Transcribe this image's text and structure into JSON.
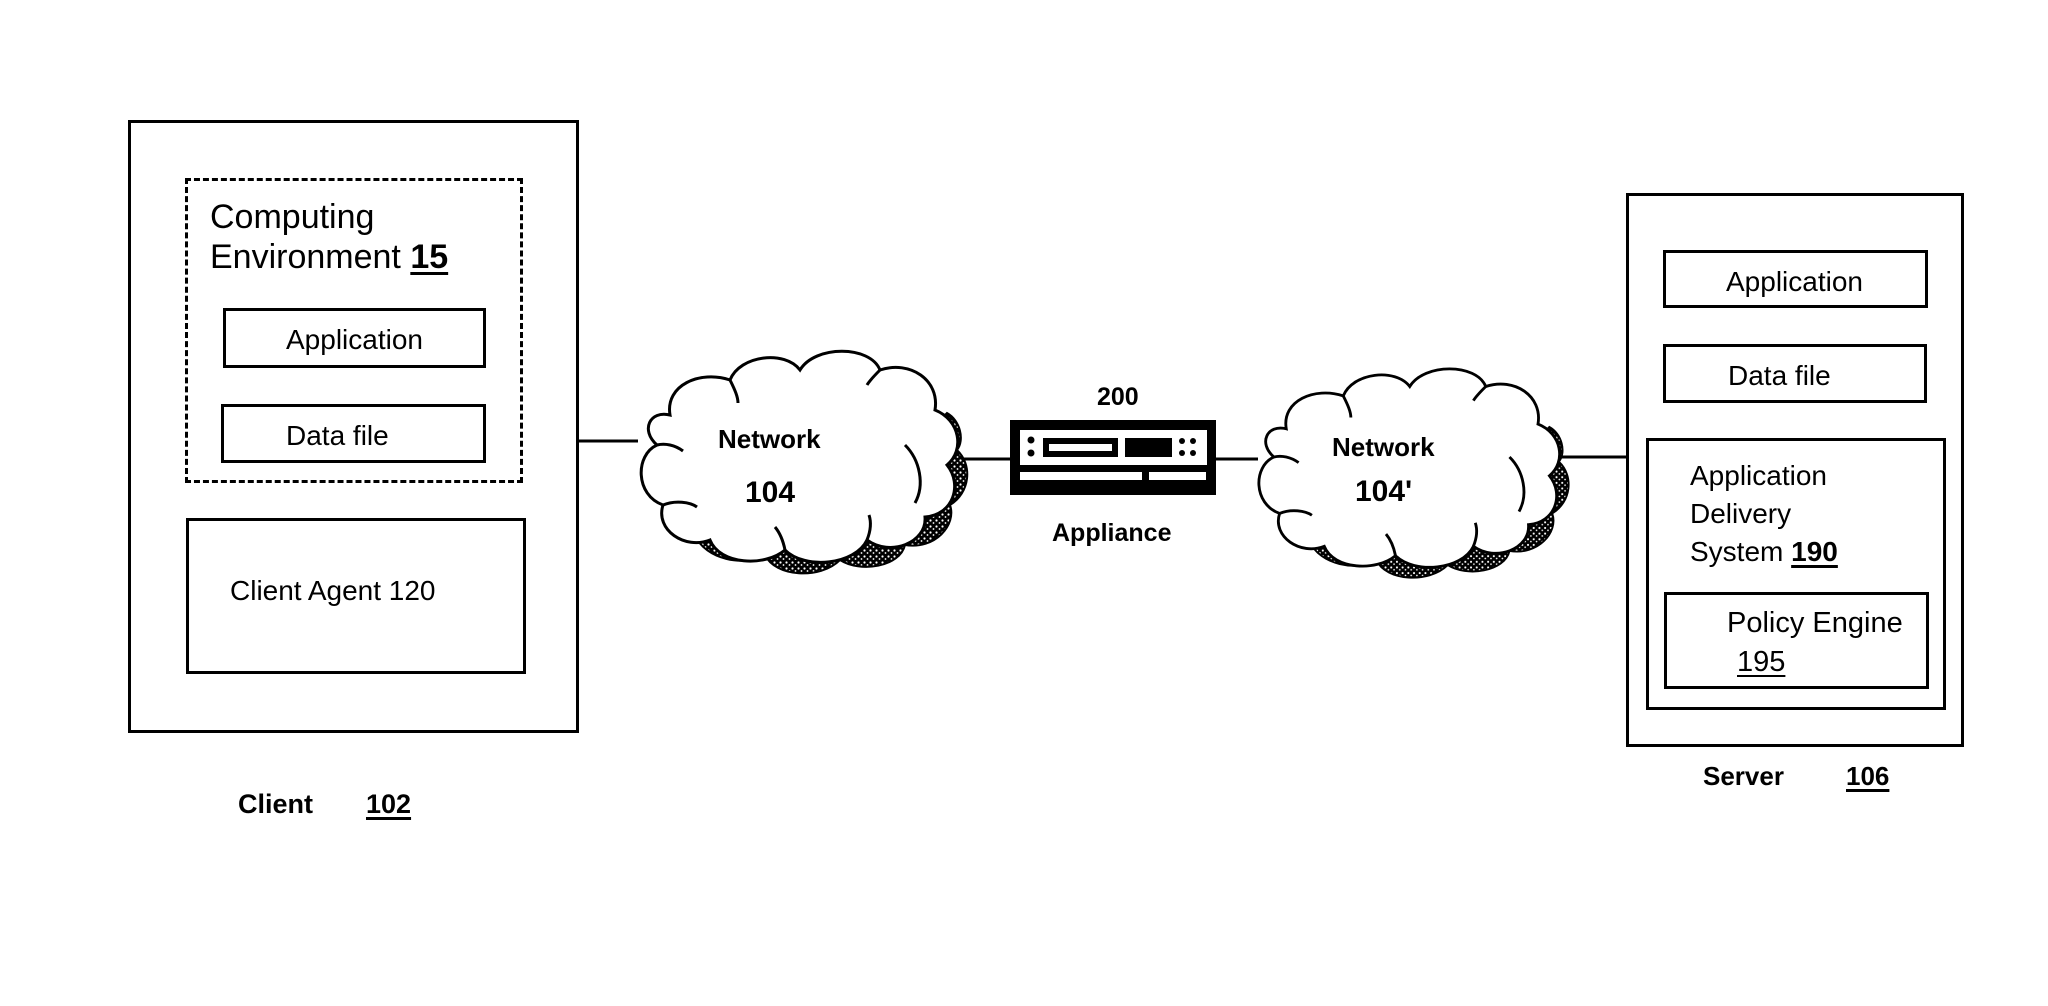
{
  "client": {
    "label": "Client",
    "ref": "102",
    "computing_environment": {
      "title_line1": "Computing",
      "title_line2": "Environment",
      "ref": "15"
    },
    "application_label": "Application",
    "data_file_label": "Data file",
    "client_agent_label": "Client Agent 120"
  },
  "network_left": {
    "label": "Network",
    "ref": "104"
  },
  "appliance": {
    "ref": "200",
    "label": "Appliance"
  },
  "network_right": {
    "label": "Network",
    "ref": "104'"
  },
  "server": {
    "label": "Server",
    "ref": "106",
    "application_label": "Application",
    "data_file_label": "Data file",
    "ads": {
      "line1": "Application",
      "line2": "Delivery",
      "line3": "System",
      "ref": "190"
    },
    "policy_engine": {
      "label": "Policy Engine",
      "ref": "195"
    }
  },
  "icons": {
    "cloud": "cloud-icon",
    "appliance": "network-appliance-icon"
  }
}
